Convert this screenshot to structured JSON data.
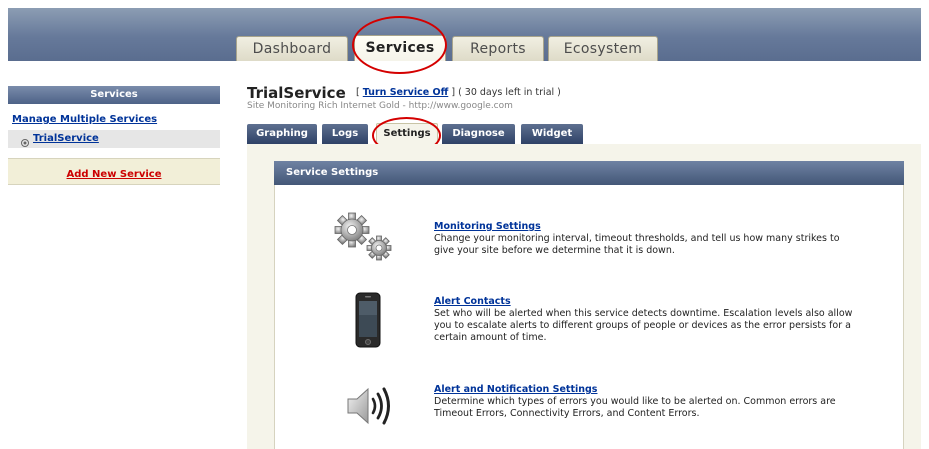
{
  "header": {
    "tabs": [
      {
        "label": "Dashboard",
        "active": false
      },
      {
        "label": "Services",
        "active": true
      },
      {
        "label": "Reports",
        "active": false
      },
      {
        "label": "Ecosystem",
        "active": false
      }
    ]
  },
  "sidebar": {
    "title": "Services",
    "manage_link": "Manage Multiple Services",
    "service_link": "TrialService",
    "add_link": "Add New Service"
  },
  "service": {
    "name": "TrialService",
    "bracket_open": "[",
    "turn_off_link": "Turn Service Off",
    "bracket_close": "]",
    "trial_note": "( 30 days left in trial )",
    "subtitle": "Site Monitoring Rich Internet Gold - http://www.google.com"
  },
  "subtabs": [
    {
      "label": "Graphing",
      "active": false
    },
    {
      "label": "Logs",
      "active": false
    },
    {
      "label": "Settings",
      "active": true
    },
    {
      "label": "Diagnose",
      "active": false
    },
    {
      "label": "Widget",
      "active": false
    }
  ],
  "panel": {
    "title": "Service Settings",
    "items": [
      {
        "title": "Monitoring Settings",
        "desc": "Change your monitoring interval, timeout thresholds, and tell us how many strikes to give your site before we determine that it is down.",
        "icon": "gears-icon"
      },
      {
        "title": "Alert Contacts",
        "desc": "Set who will be alerted when this service detects downtime. Escalation levels also allow you to escalate alerts to different groups of people or devices as the error persists for a certain amount of time.",
        "icon": "phone-icon"
      },
      {
        "title": "Alert and Notification Settings",
        "desc": "Determine which types of errors you would like to be alerted on. Common errors are Timeout Errors, Connectivity Errors, and Content Errors.",
        "icon": "speaker-icon"
      }
    ]
  },
  "colors": {
    "header": "#66799a",
    "link": "#003399",
    "highlight_circle": "#d40000",
    "add_link": "#cc0000"
  }
}
